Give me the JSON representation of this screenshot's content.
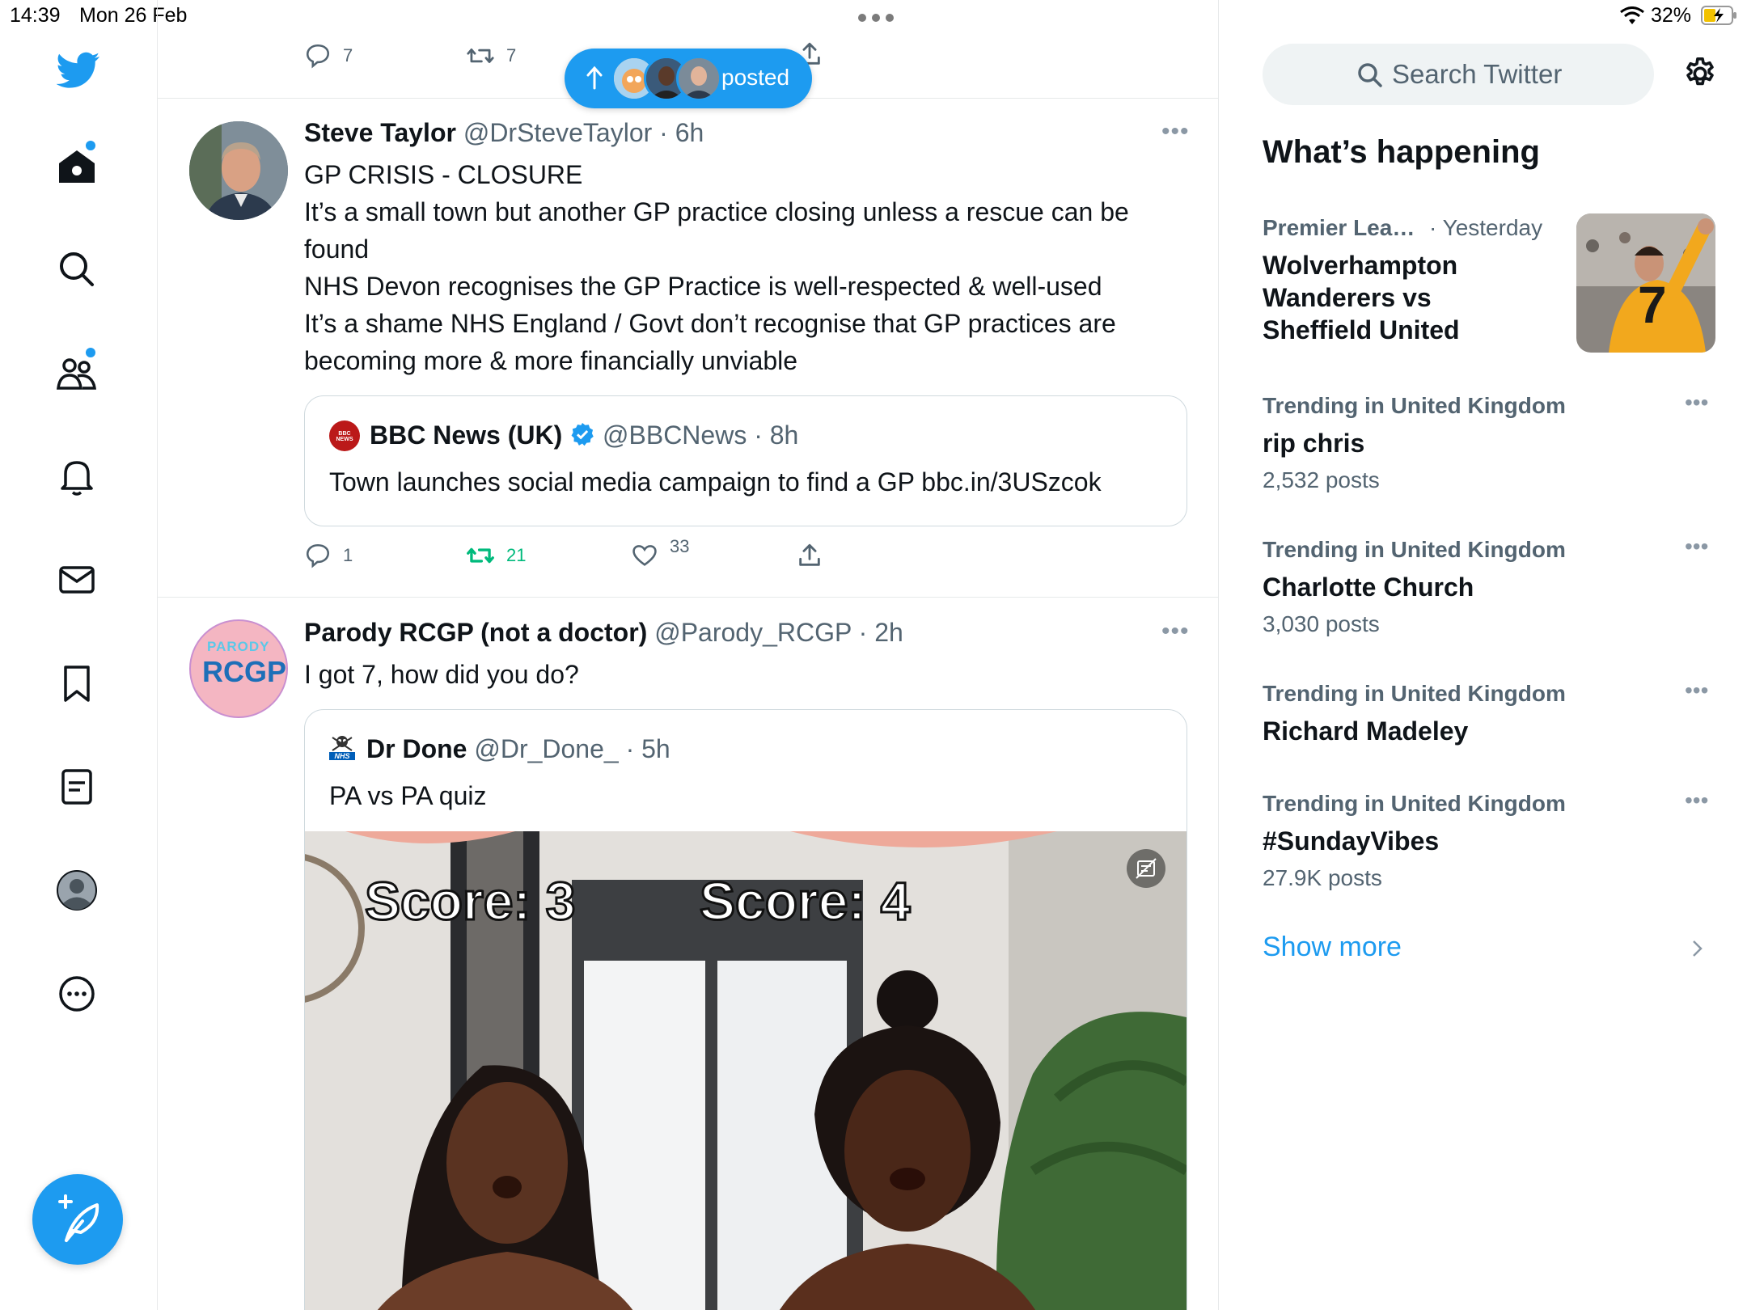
{
  "status": {
    "time": "14:39",
    "date": "Mon 26 Feb",
    "battery": "32%"
  },
  "sidebar": {
    "items": [
      {
        "name": "home",
        "label": "Home"
      },
      {
        "name": "explore",
        "label": "Search"
      },
      {
        "name": "communities",
        "label": "Communities"
      },
      {
        "name": "notifications",
        "label": "Notifications"
      },
      {
        "name": "messages",
        "label": "Messages"
      },
      {
        "name": "bookmarks",
        "label": "Bookmarks"
      },
      {
        "name": "lists",
        "label": "Lists"
      },
      {
        "name": "profile",
        "label": "Profile"
      },
      {
        "name": "more",
        "label": "More"
      }
    ]
  },
  "top_actions": {
    "replies": "7",
    "retweets": "7"
  },
  "new_posts_pill": {
    "label": "posted"
  },
  "tweets": [
    {
      "name": "Steve Taylor",
      "handle": "@DrSteveTaylor",
      "time": "6h",
      "lines": [
        "GP CRISIS - CLOSURE",
        "It’s a small town but another GP practice closing unless a rescue can be",
        "found",
        "NHS Devon recognises the GP Practice is well-respected & well-used",
        "It’s a shame NHS England / Govt don’t recognise that GP practices are",
        "becoming more & more financially unviable"
      ],
      "quote": {
        "name": "BBC News (UK)",
        "handle": "@BBCNews",
        "time": "8h",
        "text": "Town launches social media campaign to find a GP bbc.in/3USzcok",
        "logo_text": "BBC NEWS"
      },
      "actions": {
        "replies": "1",
        "retweets": "21",
        "likes": "33"
      }
    },
    {
      "name": "Parody RCGP (not a doctor)",
      "handle": "@Parody_RCGP",
      "time": "2h",
      "lines": [
        "I got 7, how did you do?"
      ],
      "avatar_top": "PARODY",
      "avatar_main": "RCGP",
      "quote": {
        "name": "Dr Done",
        "handle": "@Dr_Done_",
        "time": "5h",
        "text": "PA vs PA quiz",
        "logo_text": "NHS",
        "media": {
          "score_left": "Score: 3",
          "score_right": "Score: 4"
        }
      }
    }
  ],
  "search": {
    "placeholder": "Search Twitter"
  },
  "happening": {
    "title": "What’s happening",
    "featured": {
      "category": "Premier Lea…",
      "when": "· Yesterday",
      "line1": "Wolverhampton",
      "line2": "Wanderers vs",
      "line3": "Sheffield United",
      "jersey_number": "7"
    },
    "trends": [
      {
        "meta": "Trending in United Kingdom",
        "title": "rip chris",
        "count": "2,532 posts"
      },
      {
        "meta": "Trending in United Kingdom",
        "title": "Charlotte Church",
        "count": "3,030 posts"
      },
      {
        "meta": "Trending in United Kingdom",
        "title": "Richard Madeley",
        "count": ""
      },
      {
        "meta": "Trending in United Kingdom",
        "title": "#SundayVibes",
        "count": "27.9K posts"
      }
    ],
    "show_more": "Show more"
  },
  "colors": {
    "accent": "#1d9bf0",
    "retweet_green": "#00ba7c",
    "muted": "#536471",
    "border": "#e7e9ea"
  }
}
